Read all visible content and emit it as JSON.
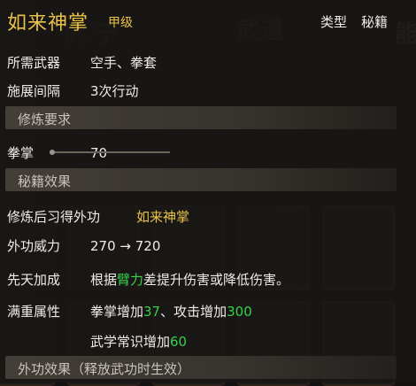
{
  "skill": {
    "name": "如来神掌",
    "grade": "甲级"
  },
  "type_info": {
    "label": "类型",
    "value": "秘籍"
  },
  "weapon": {
    "label": "所需武器",
    "value": "空手、拳套"
  },
  "interval": {
    "label": "施展间隔",
    "value": "3次行动"
  },
  "requirements_header": "修炼要求",
  "requirement": {
    "label": "拳掌",
    "value": "70"
  },
  "effects_header": "秘籍效果",
  "learn": {
    "label": "修炼后习得外功",
    "value": "如来神掌"
  },
  "power": {
    "label": "外功威力",
    "value": "270 → 720"
  },
  "innate": {
    "label": "先天加成",
    "prefix": "根据",
    "attribute": "臂力",
    "suffix": "差提升伤害或降低伤害。"
  },
  "full": {
    "label": "满重属性",
    "line1_a": "拳掌增加",
    "line1_a_val": "37",
    "line1_sep": "、攻击增加",
    "line1_b_val": "300",
    "line2_a": "武学常识增加",
    "line2_a_val": "60"
  },
  "external_header": "外功效果（释放武功时生效）"
}
